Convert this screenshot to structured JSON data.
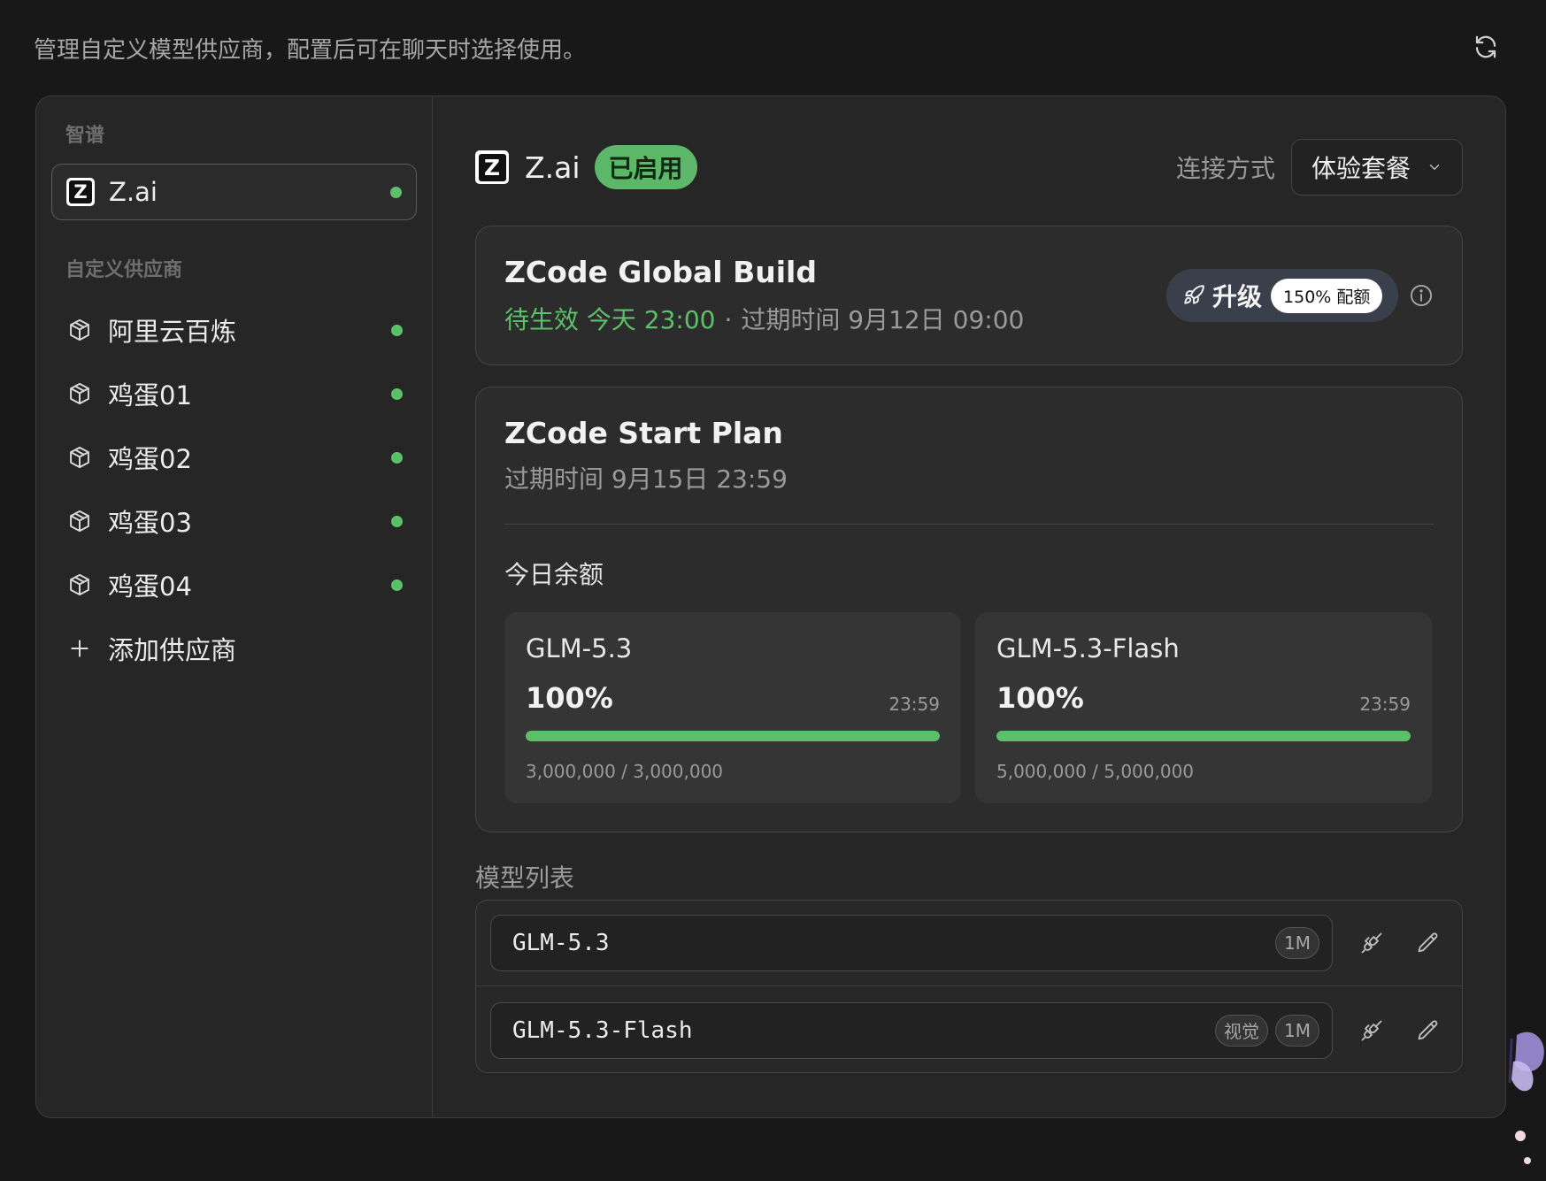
{
  "page": {
    "description": "管理自定义模型供应商，配置后可在聊天时选择使用。",
    "refresh_icon": "refresh-icon"
  },
  "sidebar": {
    "section_zhipu": "智谱",
    "zhipu_item": {
      "label": "Z.ai",
      "status": "active"
    },
    "section_custom": "自定义供应商",
    "custom_items": [
      {
        "label": "阿里云百炼",
        "icon": "box-icon"
      },
      {
        "label": "鸡蛋01",
        "icon": "box-icon"
      },
      {
        "label": "鸡蛋02",
        "icon": "box-icon"
      },
      {
        "label": "鸡蛋03",
        "icon": "box-icon"
      },
      {
        "label": "鸡蛋04",
        "icon": "box-icon"
      }
    ],
    "add_label": "添加供应商"
  },
  "header": {
    "provider_name": "Z.ai",
    "status_badge": "已启用",
    "connection_label": "连接方式",
    "connection_value": "体验套餐"
  },
  "global_build": {
    "title": "ZCode Global Build",
    "pending": "待生效 今天 23:00",
    "separator": "·",
    "expire": "过期时间 9月12日 09:00",
    "upgrade_label": "升级",
    "quota_pill": "150% 配额"
  },
  "start_plan": {
    "title": "ZCode Start Plan",
    "expire": "过期时间 9月15日 23:59",
    "today_label": "今日余额",
    "quotas": [
      {
        "model": "GLM-5.3",
        "percent": "100%",
        "fill": 1.0,
        "reset": "23:59",
        "usage": "3,000,000 / 3,000,000"
      },
      {
        "model": "GLM-5.3-Flash",
        "percent": "100%",
        "fill": 1.0,
        "reset": "23:59",
        "usage": "5,000,000 / 5,000,000"
      }
    ]
  },
  "models": {
    "label": "模型列表",
    "items": [
      {
        "name": "GLM-5.3",
        "tags": [
          "1M"
        ]
      },
      {
        "name": "GLM-5.3-Flash",
        "tags": [
          "视觉",
          "1M"
        ]
      }
    ]
  },
  "colors": {
    "accent_green": "#5cc06a",
    "background": "#181818",
    "panel": "#262626"
  }
}
